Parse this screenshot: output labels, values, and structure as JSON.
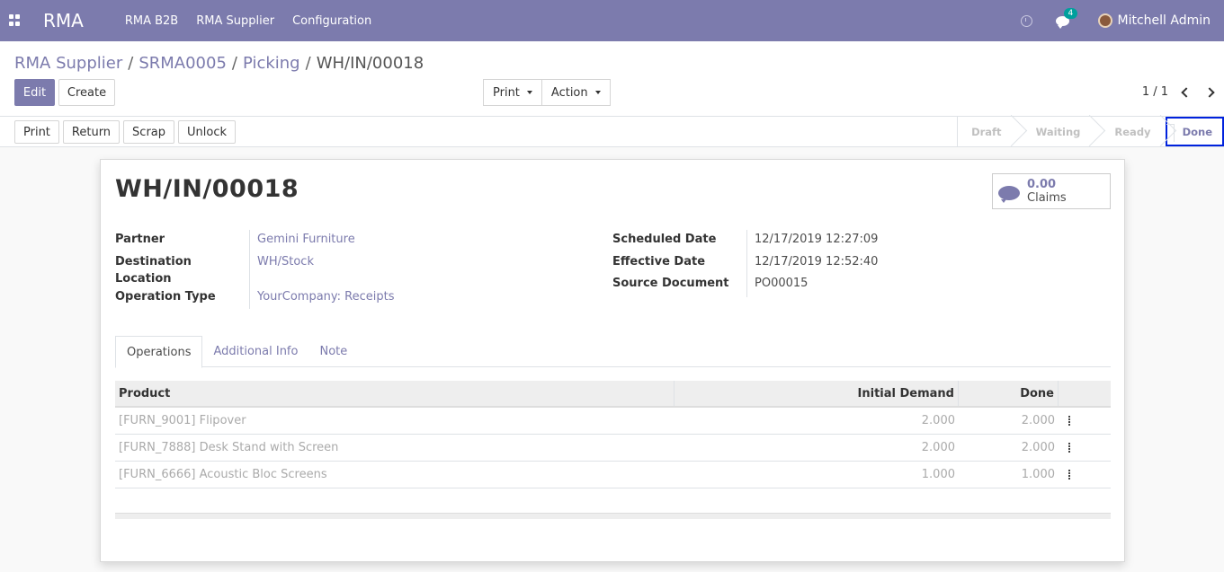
{
  "navbar": {
    "brand": "RMA",
    "menu": [
      "RMA B2B",
      "RMA Supplier",
      "Configuration"
    ],
    "messages_count": "4",
    "user": "Mitchell Admin"
  },
  "breadcrumb": {
    "items": [
      "RMA Supplier",
      "SRMA0005",
      "Picking"
    ],
    "current": "WH/IN/00018"
  },
  "buttons": {
    "edit": "Edit",
    "create": "Create",
    "print": "Print",
    "action": "Action"
  },
  "pager": {
    "value": "1 / 1"
  },
  "header_buttons": [
    "Print",
    "Return",
    "Scrap",
    "Unlock"
  ],
  "stages": [
    "Draft",
    "Waiting",
    "Ready",
    "Done"
  ],
  "active_stage": "Done",
  "record": {
    "title": "WH/IN/00018",
    "claims": {
      "value": "0.00",
      "label": "Claims"
    },
    "fields_left": [
      {
        "label": "Partner",
        "value": "Gemini Furniture"
      },
      {
        "label": "Destination Location",
        "value": "WH/Stock"
      },
      {
        "label": "Operation Type",
        "value": "YourCompany: Receipts"
      }
    ],
    "fields_right": [
      {
        "label": "Scheduled Date",
        "value": "12/17/2019 12:27:09"
      },
      {
        "label": "Effective Date",
        "value": "12/17/2019 12:52:40"
      },
      {
        "label": "Source Document",
        "value": "PO00015"
      }
    ]
  },
  "tabs": [
    "Operations",
    "Additional Info",
    "Note"
  ],
  "operations": {
    "columns": [
      "Product",
      "Initial Demand",
      "Done"
    ],
    "rows": [
      {
        "product": "[FURN_9001] Flipover",
        "demand": "2.000",
        "done": "2.000"
      },
      {
        "product": "[FURN_7888] Desk Stand with Screen",
        "demand": "2.000",
        "done": "2.000"
      },
      {
        "product": "[FURN_6666] Acoustic Bloc Screens",
        "demand": "1.000",
        "done": "1.000"
      }
    ]
  },
  "colors": {
    "brand": "#7c7bad",
    "highlight": "#0022dd"
  }
}
